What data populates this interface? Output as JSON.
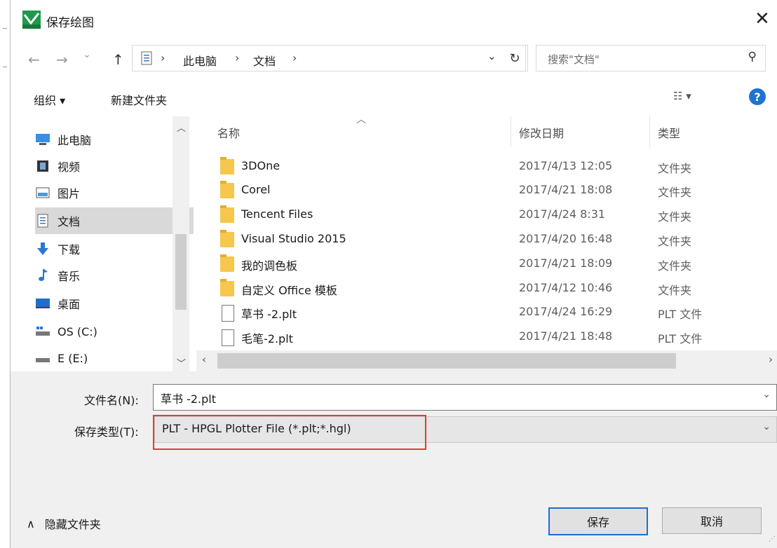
{
  "window": {
    "title": "保存绘图",
    "close_glyph": "✕"
  },
  "nav": {
    "back_glyph": "←",
    "forward_glyph": "→",
    "recent_glyph": "⌄",
    "up_glyph": "↑",
    "breadcrumbs": [
      "此电脑",
      "文档"
    ],
    "crumb_sep": "›",
    "dropdown_glyph": "⌄",
    "refresh_glyph": "↻",
    "search_placeholder": "搜索\"文档\"",
    "search_glyph": "⚲"
  },
  "toolbar": {
    "organize": "组织 ▾",
    "new_folder": "新建文件夹",
    "view_glyph": "☷ ▾",
    "help_glyph": "?"
  },
  "sidebar": {
    "items": [
      {
        "label": "此电脑",
        "icon": "computer-icon"
      },
      {
        "label": "视频",
        "icon": "video-icon"
      },
      {
        "label": "图片",
        "icon": "picture-icon"
      },
      {
        "label": "文档",
        "icon": "document-icon",
        "selected": true
      },
      {
        "label": "下载",
        "icon": "download-icon"
      },
      {
        "label": "音乐",
        "icon": "music-icon"
      },
      {
        "label": "桌面",
        "icon": "desktop-icon"
      },
      {
        "label": "OS (C:)",
        "icon": "drive-icon"
      },
      {
        "label": "E (E:)",
        "icon": "drive-icon"
      }
    ]
  },
  "filelist": {
    "headers": {
      "name": "名称",
      "date": "修改日期",
      "type": "类型"
    },
    "rows": [
      {
        "name": "3DOne",
        "date": "2017/4/13 12:05",
        "type": "文件夹",
        "kind": "folder"
      },
      {
        "name": "Corel",
        "date": "2017/4/21 18:08",
        "type": "文件夹",
        "kind": "folder"
      },
      {
        "name": "Tencent Files",
        "date": "2017/4/24 8:31",
        "type": "文件夹",
        "kind": "folder"
      },
      {
        "name": "Visual Studio 2015",
        "date": "2017/4/20 16:48",
        "type": "文件夹",
        "kind": "folder"
      },
      {
        "name": "我的调色板",
        "date": "2017/4/21 18:09",
        "type": "文件夹",
        "kind": "folder"
      },
      {
        "name": "自定义 Office 模板",
        "date": "2017/4/12 10:46",
        "type": "文件夹",
        "kind": "folder"
      },
      {
        "name": "草书 -2.plt",
        "date": "2017/4/24 16:29",
        "type": "PLT 文件",
        "kind": "file"
      },
      {
        "name": "毛笔-2.plt",
        "date": "2017/4/21 18:48",
        "type": "PLT 文件",
        "kind": "file"
      }
    ]
  },
  "form": {
    "filename_label": "文件名(N):",
    "filename_value": "草书 -2.plt",
    "filetype_label": "保存类型(T):",
    "filetype_value": "PLT - HPGL Plotter File (*.plt;*.hgl)",
    "highlight_color": "#e53935"
  },
  "buttons": {
    "save": "保存",
    "cancel": "取消",
    "hide_folders": "隐藏文件夹",
    "hide_glyph": "∧"
  },
  "colors": {
    "accent": "#1e74d0",
    "selection": "#d9d9d9",
    "folder": "#f6c74c"
  }
}
